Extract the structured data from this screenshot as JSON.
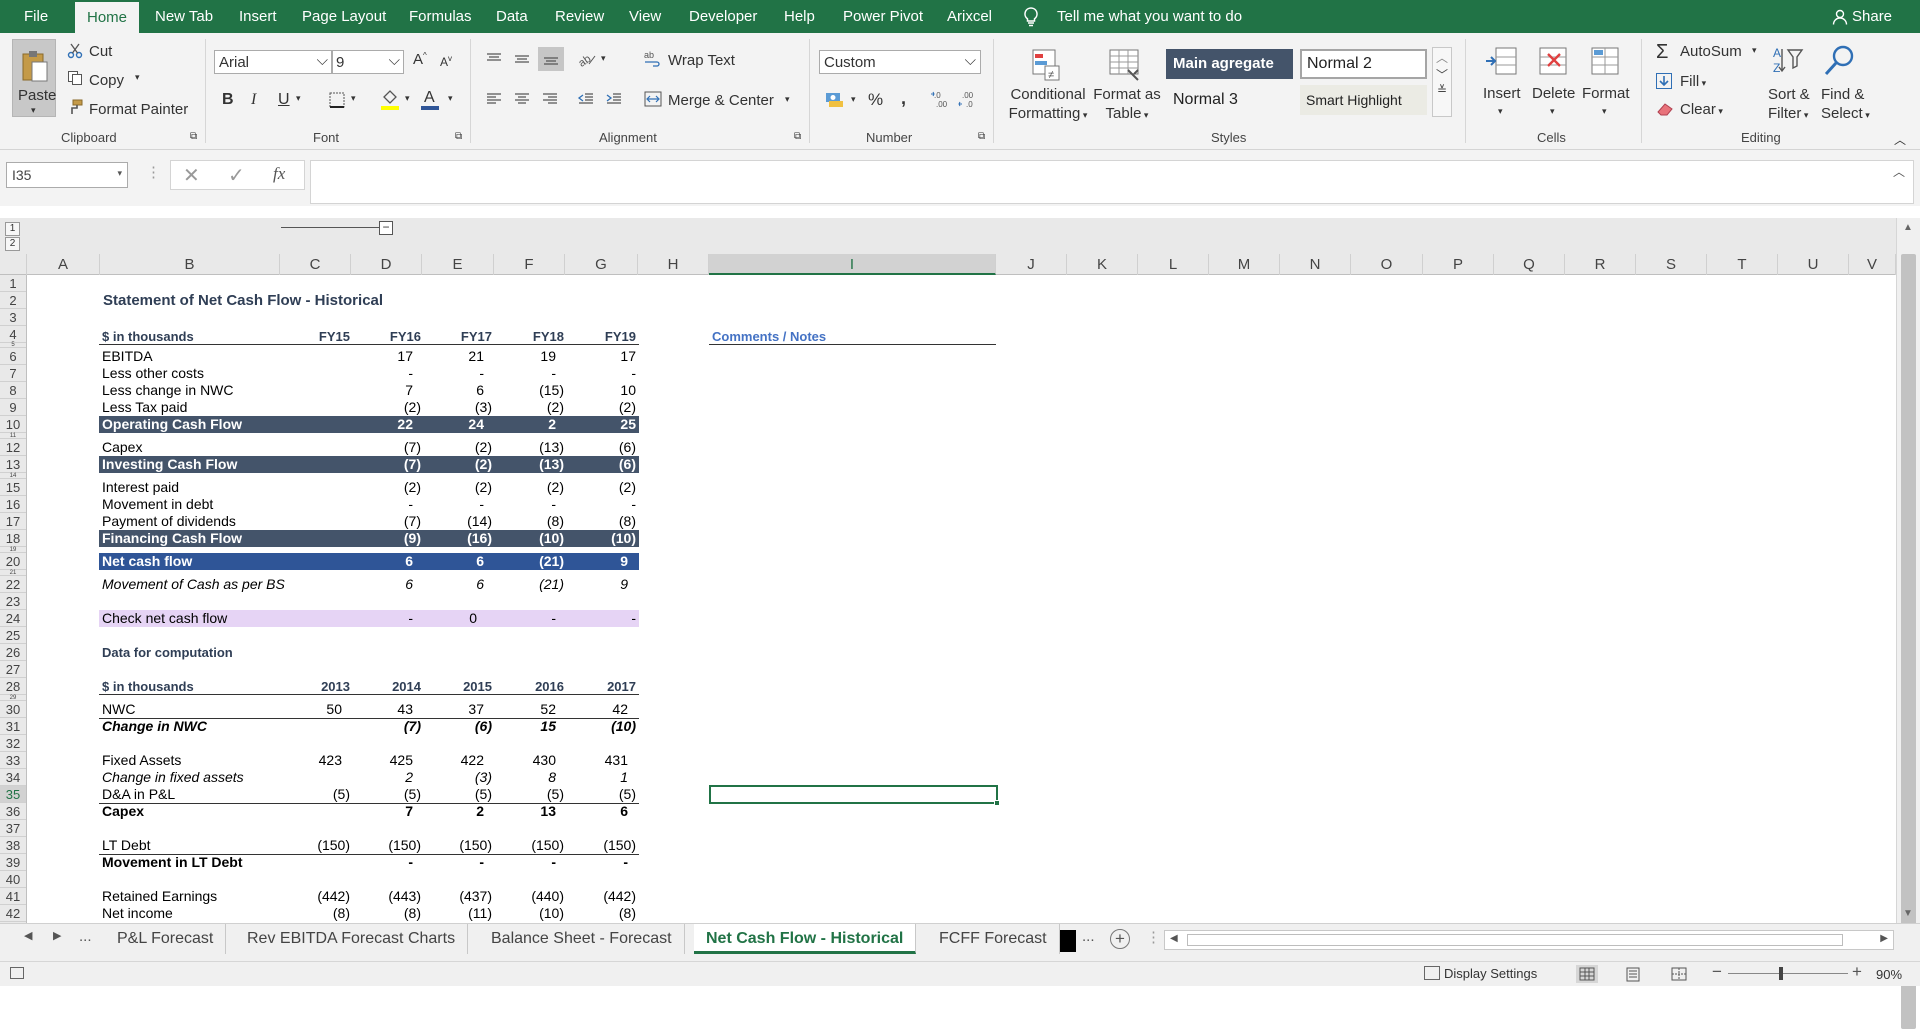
{
  "tabs": [
    "File",
    "Home",
    "New Tab",
    "Insert",
    "Page Layout",
    "Formulas",
    "Data",
    "Review",
    "View",
    "Developer",
    "Help",
    "Power Pivot",
    "Arixcel"
  ],
  "tell_me": "Tell me what you want to do",
  "share": "Share",
  "clipboard": {
    "paste": "Paste",
    "cut": "Cut",
    "copy": "Copy",
    "format_painter": "Format Painter",
    "label": "Clipboard"
  },
  "font": {
    "name": "Arial",
    "size": "9",
    "label": "Font",
    "bold": "B",
    "italic": "I",
    "underline": "U",
    "grow": "A",
    "shrink": "A"
  },
  "alignment": {
    "wrap": "Wrap Text",
    "merge": "Merge & Center",
    "label": "Alignment"
  },
  "number": {
    "format": "Custom",
    "label": "Number",
    "percent": "%",
    "comma": ","
  },
  "styles": {
    "conditional_1": "Conditional",
    "conditional_2": "Formatting",
    "table_1": "Format as",
    "table_2": "Table",
    "main_agg": "Main agregate",
    "normal2": "Normal 2",
    "normal3": "Normal 3",
    "smart": "Smart Highlight",
    "label": "Styles"
  },
  "cells": {
    "insert": "Insert",
    "delete": "Delete",
    "format": "Format",
    "label": "Cells"
  },
  "editing": {
    "autosum": "AutoSum",
    "fill": "Fill",
    "clear": "Clear",
    "sort_1": "Sort &",
    "sort_2": "Filter",
    "find_1": "Find &",
    "find_2": "Select",
    "label": "Editing"
  },
  "namebox": "I35",
  "fx": "fx",
  "columns": [
    "A",
    "B",
    "C",
    "D",
    "E",
    "F",
    "G",
    "H",
    "I",
    "J",
    "K",
    "L",
    "M",
    "N",
    "O",
    "P",
    "Q",
    "R",
    "S",
    "T",
    "U",
    "V"
  ],
  "rows": [
    "1",
    "2",
    "3",
    "4",
    "5",
    "6",
    "7",
    "8",
    "9",
    "10",
    "11",
    "12",
    "13",
    "14",
    "15",
    "16",
    "17",
    "18",
    "19",
    "20",
    "21",
    "22",
    "23",
    "24",
    "25",
    "26",
    "27",
    "28",
    "29",
    "30",
    "31",
    "32",
    "33",
    "34",
    "35",
    "36",
    "37",
    "38",
    "39",
    "40",
    "41",
    "42"
  ],
  "sheet": {
    "title": "Statement of Net Cash Flow - Historical",
    "unit": "$ in thousands",
    "years": [
      "FY15",
      "FY16",
      "FY17",
      "FY18",
      "FY19"
    ],
    "notes_header": "Comments / Notes",
    "lines": [
      {
        "label": "EBITDA",
        "v": [
          "",
          "17",
          "21",
          "19",
          "17"
        ]
      },
      {
        "label": "Less other costs",
        "v": [
          "",
          "-",
          "-",
          "-",
          "-"
        ]
      },
      {
        "label": "Less change in NWC",
        "v": [
          "",
          "7",
          "6",
          "(15)",
          "10"
        ]
      },
      {
        "label": "Less Tax paid",
        "v": [
          "",
          "(2)",
          "(3)",
          "(2)",
          "(2)"
        ]
      },
      {
        "label": "Operating Cash Flow",
        "v": [
          "",
          "22",
          "24",
          "2",
          "25"
        ]
      },
      {
        "label": "Capex",
        "v": [
          "",
          "(7)",
          "(2)",
          "(13)",
          "(6)"
        ]
      },
      {
        "label": "Investing Cash Flow",
        "v": [
          "",
          "(7)",
          "(2)",
          "(13)",
          "(6)"
        ]
      },
      {
        "label": "Interest paid",
        "v": [
          "",
          "(2)",
          "(2)",
          "(2)",
          "(2)"
        ]
      },
      {
        "label": "Movement in debt",
        "v": [
          "",
          "-",
          "-",
          "-",
          "-"
        ]
      },
      {
        "label": "Payment of dividends",
        "v": [
          "",
          "(7)",
          "(14)",
          "(8)",
          "(8)"
        ]
      },
      {
        "label": "Financing Cash Flow",
        "v": [
          "",
          "(9)",
          "(16)",
          "(10)",
          "(10)"
        ]
      },
      {
        "label": "Net cash flow",
        "v": [
          "",
          "6",
          "6",
          "(21)",
          "9"
        ]
      },
      {
        "label": "Movement of Cash as per BS",
        "v": [
          "",
          "6",
          "6",
          "(21)",
          "9"
        ]
      },
      {
        "label": "Check net cash flow",
        "v": [
          "",
          "-",
          "0",
          "-",
          "-"
        ]
      }
    ],
    "data_title": "Data for computation",
    "data_unit": "$ in thousands",
    "data_years": [
      "2013",
      "2014",
      "2015",
      "2016",
      "2017"
    ],
    "data_lines": [
      {
        "label": "NWC",
        "v": [
          "50",
          "43",
          "37",
          "52",
          "42"
        ]
      },
      {
        "label": "Change in NWC",
        "v": [
          "",
          "(7)",
          "(6)",
          "15",
          "(10)"
        ]
      },
      {
        "label": "Fixed Assets",
        "v": [
          "423",
          "425",
          "422",
          "430",
          "431"
        ]
      },
      {
        "label": "Change in fixed assets",
        "v": [
          "",
          "2",
          "(3)",
          "8",
          "1"
        ]
      },
      {
        "label": "D&A in P&L",
        "v": [
          "(5)",
          "(5)",
          "(5)",
          "(5)",
          "(5)"
        ]
      },
      {
        "label": "Capex",
        "v": [
          "",
          "7",
          "2",
          "13",
          "6"
        ]
      },
      {
        "label": "LT Debt",
        "v": [
          "(150)",
          "(150)",
          "(150)",
          "(150)",
          "(150)"
        ]
      },
      {
        "label": "Movement in LT Debt",
        "v": [
          "",
          "-",
          "-",
          "-",
          "-"
        ]
      },
      {
        "label": "Retained Earnings",
        "v": [
          "(442)",
          "(443)",
          "(437)",
          "(440)",
          "(442)"
        ]
      },
      {
        "label": "Net income",
        "v": [
          "(8)",
          "(8)",
          "(11)",
          "(10)",
          "(8)"
        ]
      }
    ]
  },
  "sheet_tabs": [
    "P&L Forecast",
    "Rev EBITDA Forecast Charts",
    "Balance Sheet - Forecast",
    "Net Cash Flow - Historical",
    "FCFF Forecast"
  ],
  "nav": {
    "ellipsis": "...",
    "plus": "+",
    "more": "..."
  },
  "status": {
    "display_settings": "Display Settings",
    "zoom": "90%",
    "minus": "−",
    "plus": "+"
  },
  "colors": {
    "ribbon_green": "#217346",
    "band_dark": "#44546a",
    "band_blue": "#2f5597",
    "check_purple": "#e6d4f5",
    "header_text": "#2f3e55",
    "notes_blue": "#4472c4"
  }
}
